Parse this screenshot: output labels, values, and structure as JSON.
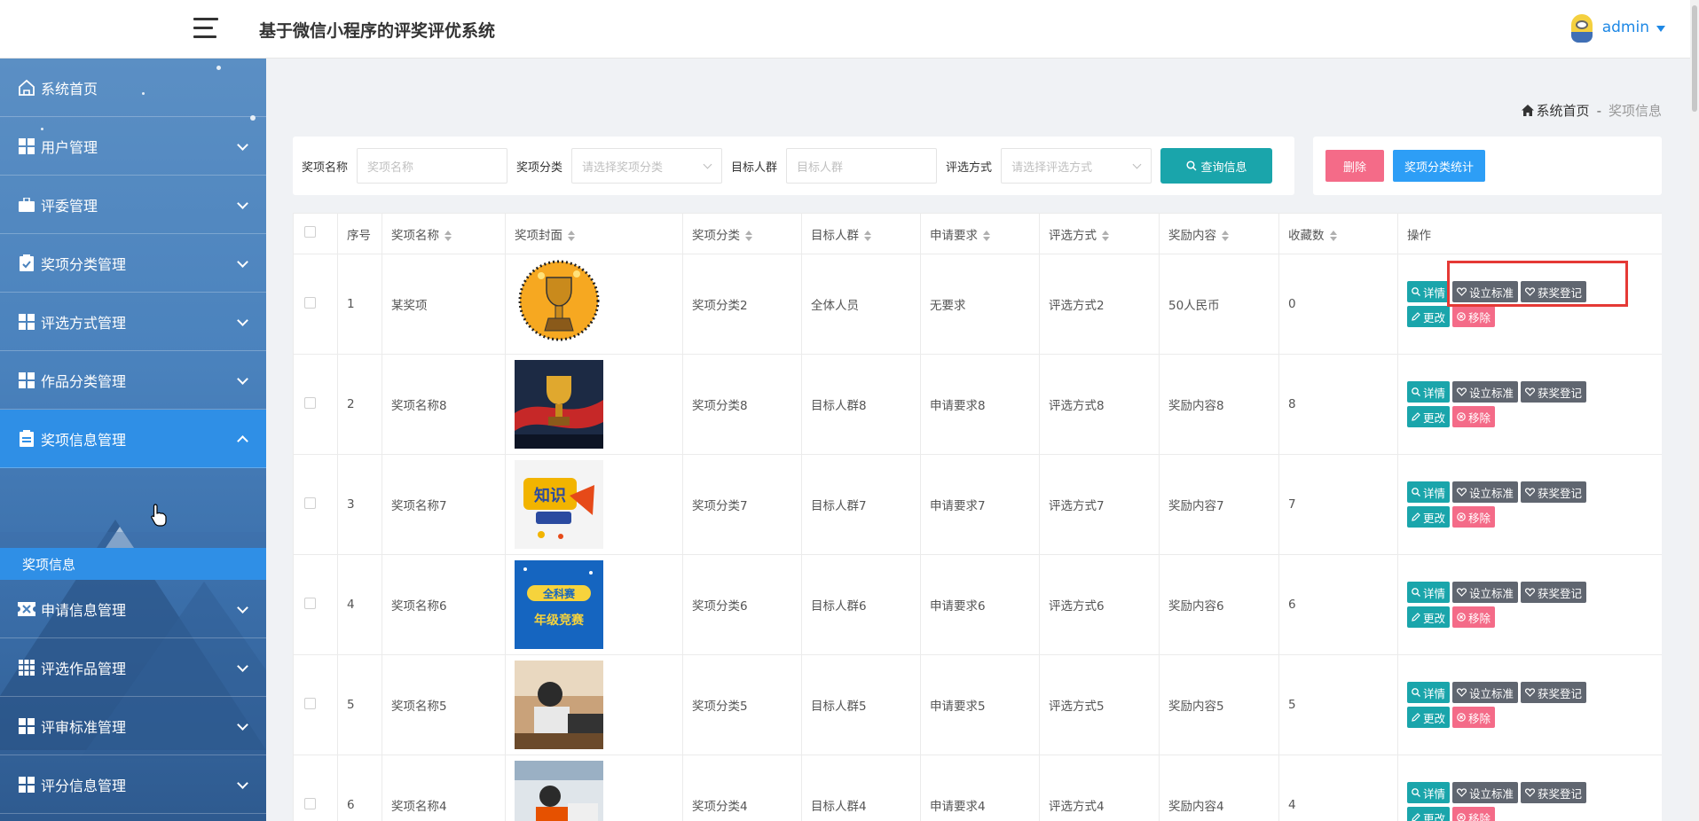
{
  "header": {
    "title": "基于微信小程序的评奖评优系统",
    "user": "admin"
  },
  "sidebar": {
    "items": [
      {
        "label": "系统首页",
        "icon": "home-icon"
      },
      {
        "label": "用户管理",
        "icon": "grid-icon"
      },
      {
        "label": "评委管理",
        "icon": "briefcase-icon"
      },
      {
        "label": "奖项分类管理",
        "icon": "clipboard-check-icon"
      },
      {
        "label": "评选方式管理",
        "icon": "grid-icon"
      },
      {
        "label": "作品分类管理",
        "icon": "grid-icon"
      },
      {
        "label": "奖项信息管理",
        "icon": "clipboard-icon"
      },
      {
        "label": "申请信息管理",
        "icon": "ticket-icon"
      },
      {
        "label": "评选作品管理",
        "icon": "grid-9-icon"
      },
      {
        "label": "评审标准管理",
        "icon": "grid-icon"
      },
      {
        "label": "评分信息管理",
        "icon": "grid-icon"
      }
    ],
    "sub_item": "奖项信息"
  },
  "breadcrumb": {
    "home": "系统首页",
    "separator": "-",
    "current": "奖项信息"
  },
  "search": {
    "name_label": "奖项名称",
    "name_placeholder": "奖项名称",
    "category_label": "奖项分类",
    "category_placeholder": "请选择奖项分类",
    "target_label": "目标人群",
    "target_placeholder": "目标人群",
    "method_label": "评选方式",
    "method_placeholder": "请选择评选方式",
    "query_button": "查询信息"
  },
  "actions": {
    "delete": "删除",
    "stats": "奖项分类统计"
  },
  "table": {
    "headers": [
      "序号",
      "奖项名称",
      "奖项封面",
      "奖项分类",
      "目标人群",
      "申请要求",
      "评选方式",
      "奖励内容",
      "收藏数",
      "操作"
    ],
    "rows": [
      {
        "no": "1",
        "name": "某奖项",
        "cover": "trophy-gold",
        "category": "奖项分类2",
        "target": "全体人员",
        "req": "无要求",
        "method": "评选方式2",
        "reward": "50人民币",
        "fav": "0"
      },
      {
        "no": "2",
        "name": "奖项名称8",
        "cover": "trophy-red",
        "category": "奖项分类8",
        "target": "目标人群8",
        "req": "申请要求8",
        "method": "评选方式8",
        "reward": "奖励内容8",
        "fav": "8"
      },
      {
        "no": "3",
        "name": "奖项名称7",
        "cover": "quiz-logo",
        "category": "奖项分类7",
        "target": "目标人群7",
        "req": "申请要求7",
        "method": "评选方式7",
        "reward": "奖励内容7",
        "fav": "7"
      },
      {
        "no": "4",
        "name": "奖项名称6",
        "cover": "blue-poster",
        "category": "奖项分类6",
        "target": "目标人群6",
        "req": "申请要求6",
        "method": "评选方式6",
        "reward": "奖励内容6",
        "fav": "6"
      },
      {
        "no": "5",
        "name": "奖项名称5",
        "cover": "exam-photo",
        "category": "奖项分类5",
        "target": "目标人群5",
        "req": "申请要求5",
        "method": "评选方式5",
        "reward": "奖励内容5",
        "fav": "5"
      },
      {
        "no": "6",
        "name": "奖项名称4",
        "cover": "study-photo",
        "category": "奖项分类4",
        "target": "目标人群4",
        "req": "申请要求4",
        "method": "评选方式4",
        "reward": "奖励内容4",
        "fav": "4"
      }
    ],
    "ops": {
      "detail": "详情",
      "standard": "设立标准",
      "award": "获奖登记",
      "edit": "更改",
      "remove": "移除"
    }
  },
  "colors": {
    "accent": "#1aa5ab",
    "danger": "#f46b88",
    "primary": "#2d9ef6",
    "active_nav": "#2f8fe6"
  }
}
